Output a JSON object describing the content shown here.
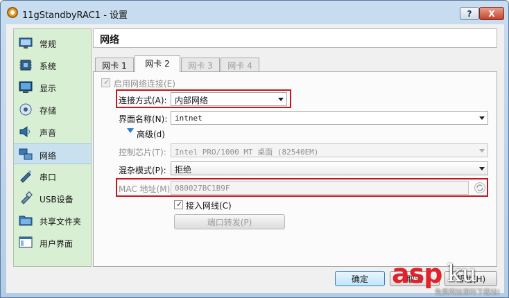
{
  "window": {
    "title": "11gStandbyRAC1 - 设置",
    "help_label": "?",
    "close_label": "X"
  },
  "sidebar": {
    "items": [
      {
        "label": "常规",
        "icon": "monitor-icon"
      },
      {
        "label": "系统",
        "icon": "chip-icon"
      },
      {
        "label": "显示",
        "icon": "display-icon"
      },
      {
        "label": "存储",
        "icon": "storage-icon"
      },
      {
        "label": "声音",
        "icon": "speaker-icon"
      },
      {
        "label": "网络",
        "icon": "network-icon",
        "selected": true
      },
      {
        "label": "串口",
        "icon": "serial-port-icon"
      },
      {
        "label": "USB设备",
        "icon": "usb-icon"
      },
      {
        "label": "共享文件夹",
        "icon": "folder-icon"
      },
      {
        "label": "用户界面",
        "icon": "window-icon"
      }
    ]
  },
  "page": {
    "title": "网络"
  },
  "tabs": [
    {
      "label": "网卡 1",
      "state": "normal"
    },
    {
      "label": "网卡 2",
      "state": "active"
    },
    {
      "label": "网卡 3",
      "state": "disabled"
    },
    {
      "label": "网卡 4",
      "state": "disabled"
    }
  ],
  "adapter": {
    "enable_label": "启用网络连接(E)",
    "enable_checked": true,
    "attached_label": "连接方式(A):",
    "attached_value": "内部网络",
    "name_label": "界面名称(N):",
    "name_value": "intnet",
    "advanced_label": "高级(d)",
    "type_label": "控制芯片(T):",
    "type_value": "Intel PRO/1000 MT 桌面 (82540EM)",
    "promisc_label": "混杂模式(P):",
    "promisc_value": "拒绝",
    "mac_label": "MAC 地址(M):",
    "mac_value": "080027BC1B9F",
    "cable_label": "接入网线(C)",
    "cable_checked": true,
    "port_forward_label": "端口转发(P)"
  },
  "footer": {
    "ok_label": "确定",
    "cancel_label": "取消",
    "help_label": "帮助(H)"
  },
  "watermark": {
    "brand_a": "asp",
    "brand_b": "ku",
    "tagline": "免费网站源码下载站!"
  },
  "colors": {
    "highlight_box": "#c8141b",
    "sidebar_bg": "#d9efd4",
    "selected_item": "#c9e0ef"
  }
}
